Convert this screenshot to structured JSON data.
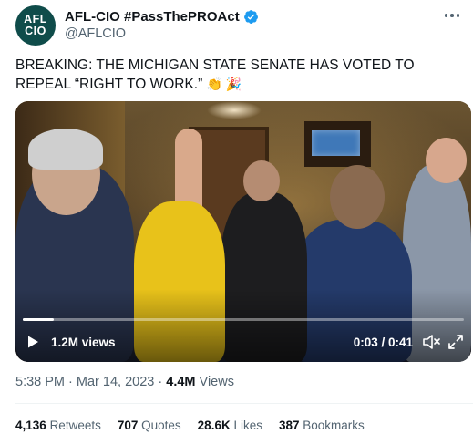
{
  "account": {
    "avatar_line1": "AFL",
    "avatar_line2": "CIO",
    "display_name": "AFL-CIO #PassThePROAct",
    "handle": "@AFLCIO"
  },
  "tweet": {
    "text": "BREAKING: THE MICHIGAN STATE SENATE HAS VOTED TO REPEAL “RIGHT TO WORK.”",
    "emoji": "👏 🎉"
  },
  "video": {
    "views": "1.2M views",
    "time": "0:03 / 0:41",
    "progress": 0.07
  },
  "meta": {
    "time": "5:38 PM",
    "sep1": "·",
    "date": "Mar 14, 2023",
    "sep2": "·",
    "views_count": "4.4M",
    "views_label": "Views"
  },
  "stats": [
    {
      "count": "4,136",
      "label": "Retweets"
    },
    {
      "count": "707",
      "label": "Quotes"
    },
    {
      "count": "28.6K",
      "label": "Likes"
    },
    {
      "count": "387",
      "label": "Bookmarks"
    }
  ],
  "colors": {
    "verified": "#1d9bf0",
    "avatar_bg": "#0f4c4a",
    "secondary_text": "#536471"
  },
  "icons": [
    "verified-badge-icon",
    "more-icon",
    "play-icon",
    "volume-icon",
    "fullscreen-icon"
  ]
}
